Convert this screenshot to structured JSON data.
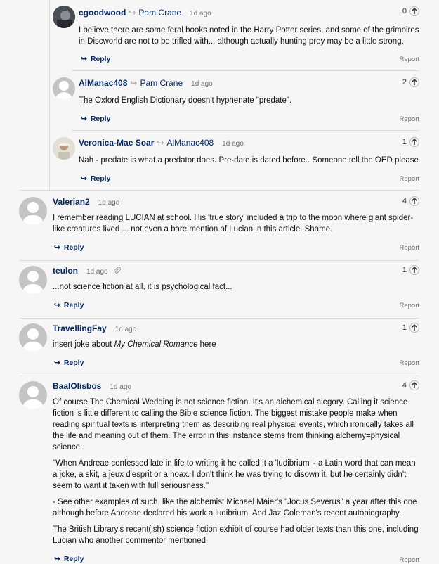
{
  "comments": [
    {
      "username": "cgoodwood",
      "reply_to": "Pam Crane",
      "time": "1d ago",
      "votes": "0",
      "paragraphs": [
        "I believe there are some feral books noted in the Harry Potter series, and some of the grimoires in Discworld are not to be trifled with... although actually hunting prey may be a little strong."
      ],
      "reply_label": "Reply",
      "report_label": "Report"
    },
    {
      "username": "AlManac408",
      "reply_to": "Pam Crane",
      "time": "1d ago",
      "votes": "2",
      "paragraphs": [
        "The Oxford English Dictionary doesn't hyphenate \"predate\"."
      ],
      "reply_label": "Reply",
      "report_label": "Report"
    },
    {
      "username": "Veronica-Mae Soar",
      "reply_to": "AlManac408",
      "time": "1d ago",
      "votes": "1",
      "paragraphs": [
        "Nah - predate is what a predator does. Pre-date is dated before.. Someone tell the OED please"
      ],
      "reply_label": "Reply",
      "report_label": "Report"
    },
    {
      "username": "Valerian2",
      "time": "1d ago",
      "votes": "4",
      "paragraphs": [
        "I remember reading LUCIAN at school. His 'true story' included a trip to the moon where giant spider-like creatures lived ... not even a bare mention of Lucian in this article. Shame."
      ],
      "reply_label": "Reply",
      "report_label": "Report"
    },
    {
      "username": "teulon",
      "time": "1d ago",
      "votes": "1",
      "paragraphs": [
        "...not science fiction at all, it is psychological fact..."
      ],
      "reply_label": "Reply",
      "report_label": "Report"
    },
    {
      "username": "TravellingFay",
      "time": "1d ago",
      "votes": "1",
      "text_before": "insert joke about ",
      "text_italic": "My Chemical Romance",
      "text_after": " here",
      "reply_label": "Reply",
      "report_label": "Report"
    },
    {
      "username": "BaalOlisbos",
      "time": "1d ago",
      "votes": "4",
      "paragraphs": [
        "Of course The Chemical Wedding is not science fiction. It's an alchemical alegory. Calling it science fiction is little different to calling the Bible science fiction. The biggest mistake people make when reading spiritual texts is interpreting them as describing real physical events, which ironically takes all the life and meaning out of them. The error in this instance stems from thinking alchemy=physical science.",
        "\"When Andreae confessed late in life to writing it he called it a 'ludibrium' - a Latin word that can mean a joke, a skit, a jeux d'esprit or a hoax. I don't think he was trying to disown it, but he certainly didn't seem to want it taken with full seriousness.\"",
        "- See other examples of such, like the alchemist Michael Maier's \"Jocus Severus\" a year after this one although before Andreae declared his work a ludibrium. And Jaz Coleman's recent autobiography.",
        "The British Library's recent(ish) science fiction exhibit of course had older texts than this one, including Lucian who another commentor mentioned."
      ],
      "reply_label": "Reply",
      "report_label": "Report"
    }
  ]
}
